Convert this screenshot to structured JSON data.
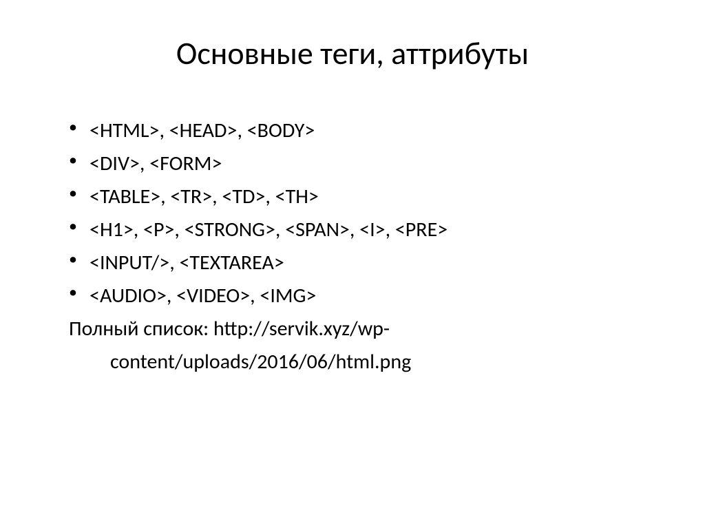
{
  "slide": {
    "title": "Основные теги, аттрибуты",
    "bullets": [
      "<HTML>, <HEAD>, <BODY>",
      "<DIV>, <FORM>",
      "<TABLE>, <TR>, <TD>, <TH>",
      "<H1>, <P>, <STRONG>, <SPAN>, <I>, <PRE>",
      "<INPUT/>, <TEXTAREA>",
      "<AUDIO>, <VIDEO>, <IMG>"
    ],
    "footer_line1": "Полный список: http://servik.xyz/wp-",
    "footer_line2": "content/uploads/2016/06/html.png"
  }
}
